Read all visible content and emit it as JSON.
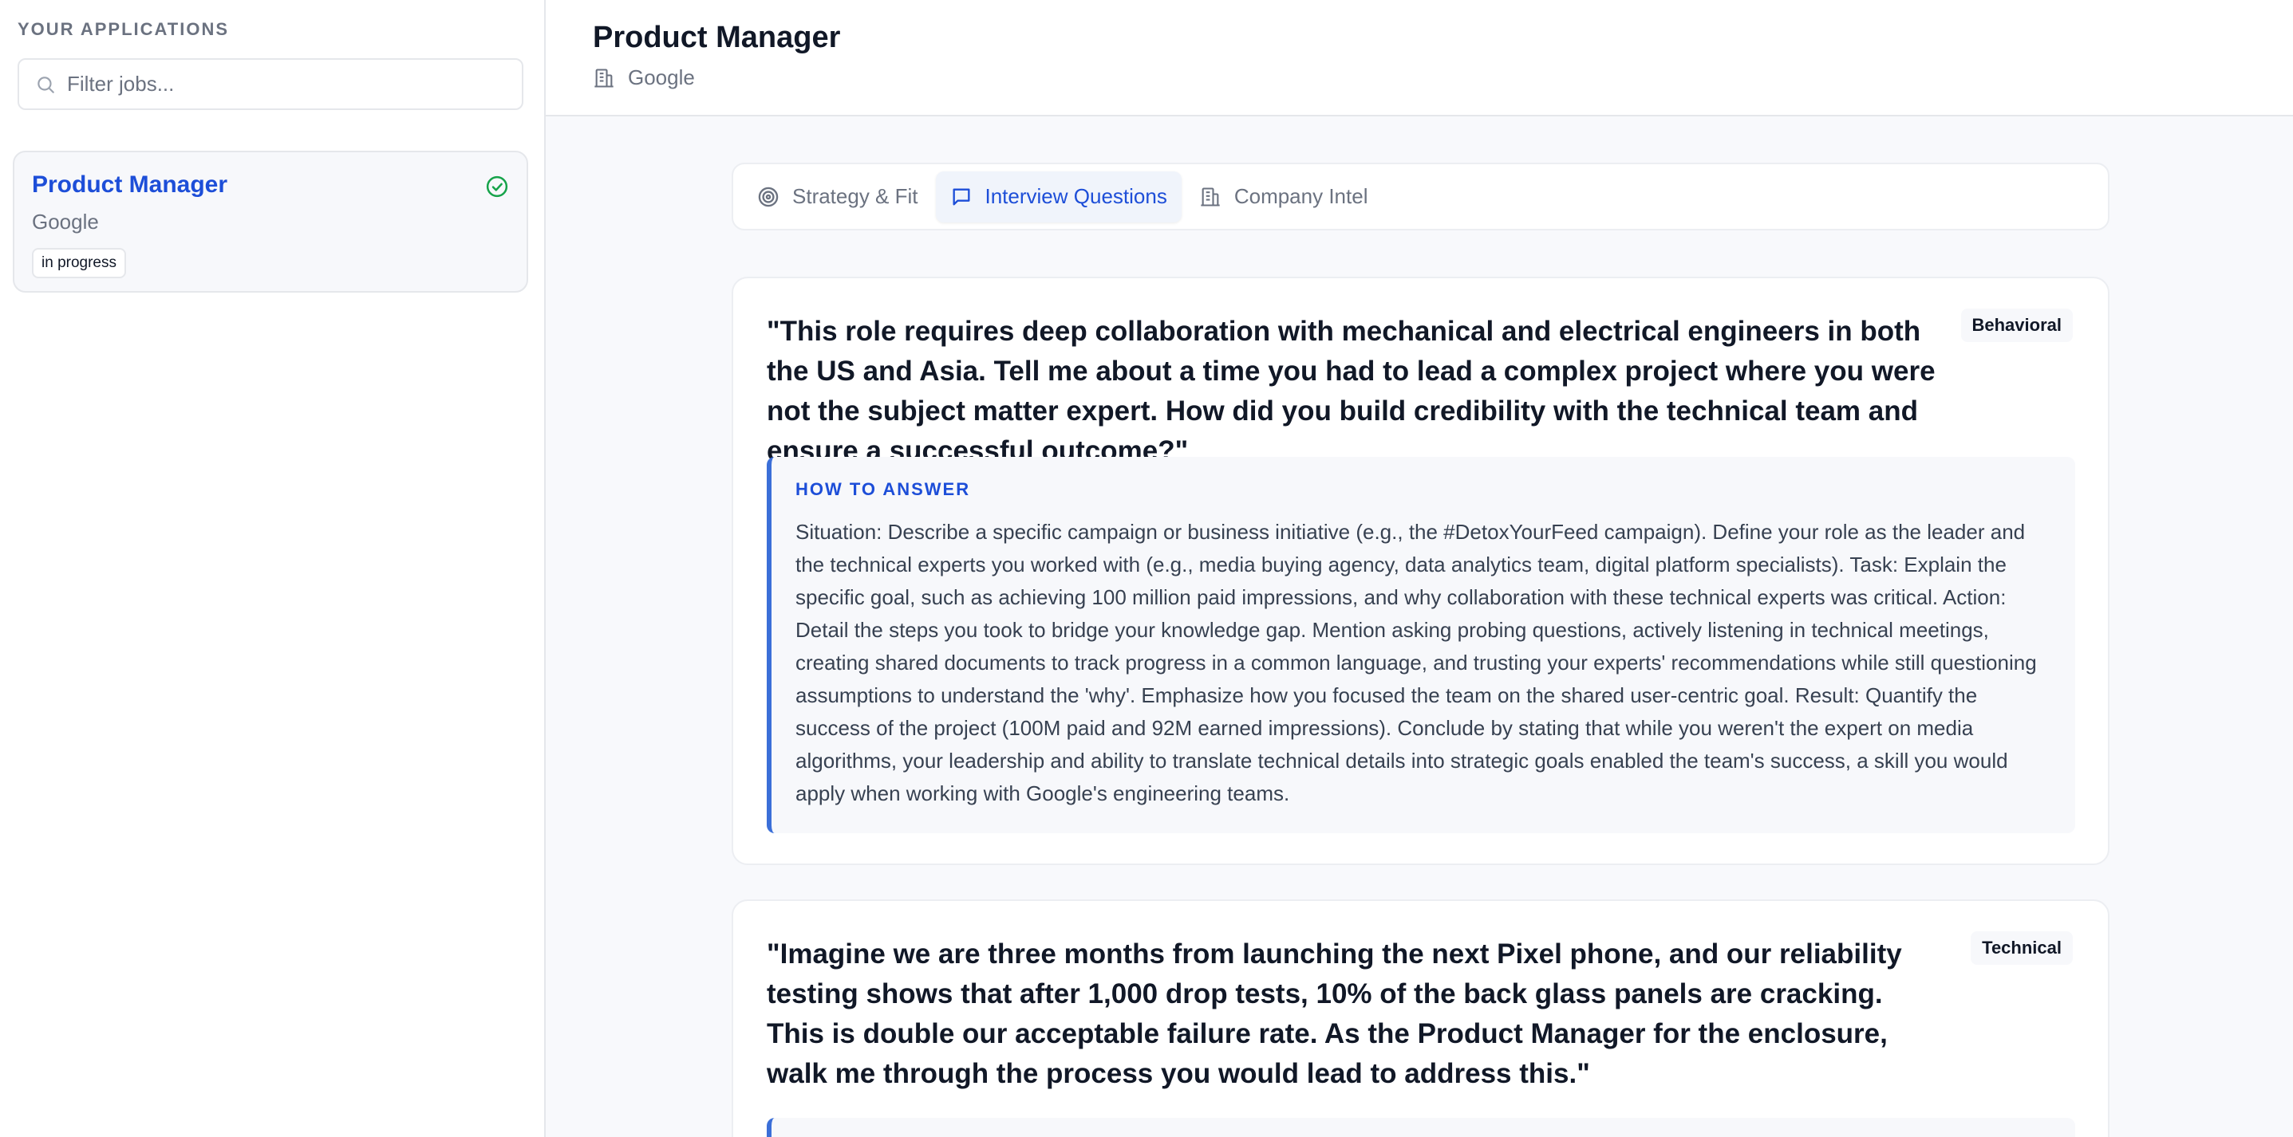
{
  "sidebar": {
    "heading": "YOUR APPLICATIONS",
    "search_placeholder": "Filter jobs...",
    "jobs": [
      {
        "title": "Product Manager",
        "company": "Google",
        "status": "in progress"
      }
    ]
  },
  "header": {
    "title": "Product Manager",
    "company": "Google"
  },
  "tabs": [
    {
      "label": "Strategy & Fit",
      "icon": "target-icon",
      "active": false
    },
    {
      "label": "Interview Questions",
      "icon": "message-square-icon",
      "active": true
    },
    {
      "label": "Company Intel",
      "icon": "building-icon",
      "active": false
    }
  ],
  "questions": [
    {
      "text": "\"This role requires deep collaboration with mechanical and electrical engineers in both the US and Asia. Tell me about a time you had to lead a complex project where you were not the subject matter expert. How did you build credibility with the technical team and ensure a successful outcome?\"",
      "category": "Behavioral",
      "answer_label": "HOW TO ANSWER",
      "answer": "Situation: Describe a specific campaign or business initiative (e.g., the #DetoxYourFeed campaign). Define your role as the leader and the technical experts you worked with (e.g., media buying agency, data analytics team, digital platform specialists). Task: Explain the specific goal, such as achieving 100 million paid impressions, and why collaboration with these technical experts was critical. Action: Detail the steps you took to bridge your knowledge gap. Mention asking probing questions, actively listening in technical meetings, creating shared documents to track progress in a common language, and trusting your experts' recommendations while still questioning assumptions to understand the 'why'. Emphasize how you focused the team on the shared user-centric goal. Result: Quantify the success of the project (100M paid and 92M earned impressions). Conclude by stating that while you weren't the expert on media algorithms, your leadership and ability to translate technical details into strategic goals enabled the team's success, a skill you would apply when working with Google's engineering teams."
    },
    {
      "text": "\"Imagine we are three months from launching the next Pixel phone, and our reliability testing shows that after 1,000 drop tests, 10% of the back glass panels are cracking. This is double our acceptable failure rate. As the Product Manager for the enclosure, walk me through the process you would lead to address this.\"",
      "category": "Technical"
    }
  ],
  "colors": {
    "accent": "#1d4ed8",
    "success": "#16a34a",
    "answer_border": "#3b6fd8"
  }
}
